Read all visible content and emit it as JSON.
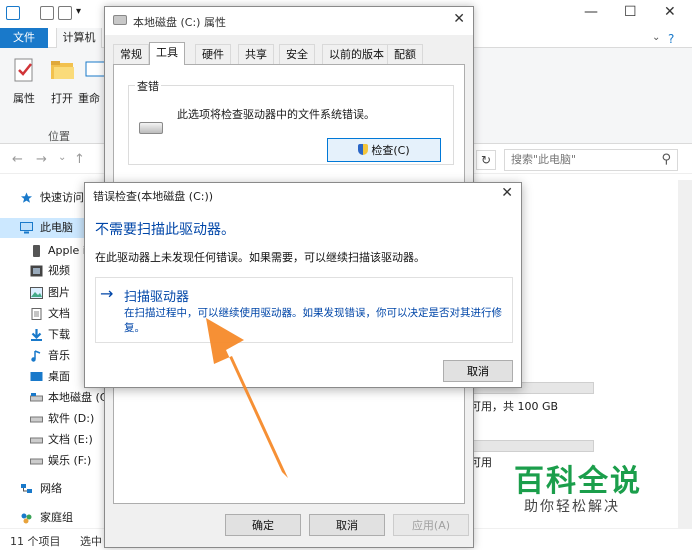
{
  "explorer": {
    "ribbon_tabs": {
      "file": "文件",
      "computer": "计算机"
    },
    "ribbon_buttons": [
      {
        "label": "属性",
        "icon": "properties-icon"
      },
      {
        "label": "打开",
        "icon": "open-folder-icon"
      },
      {
        "label": "重命",
        "icon": "rename-icon"
      }
    ],
    "ribbon_group": "位置",
    "search_placeholder": "搜索\"此电脑\"",
    "nav": [
      {
        "label": "快速访问",
        "icon": "star-icon"
      },
      {
        "label": "此电脑",
        "icon": "pc-icon"
      },
      {
        "label": "Apple i",
        "icon": "phone-icon"
      },
      {
        "label": "视频",
        "icon": "video-icon"
      },
      {
        "label": "图片",
        "icon": "pictures-icon"
      },
      {
        "label": "文档",
        "icon": "documents-icon"
      },
      {
        "label": "下载",
        "icon": "download-icon"
      },
      {
        "label": "音乐",
        "icon": "music-icon"
      },
      {
        "label": "桌面",
        "icon": "desktop-icon"
      },
      {
        "label": "本地磁盘 (C:)",
        "icon": "drive-icon"
      },
      {
        "label": "软件 (D:)",
        "icon": "drive-icon"
      },
      {
        "label": "文档 (E:)",
        "icon": "drive-icon"
      },
      {
        "label": "娱乐 (F:)",
        "icon": "drive-icon"
      },
      {
        "label": "网络",
        "icon": "network-icon"
      },
      {
        "label": "家庭组",
        "icon": "homegroup-icon"
      }
    ],
    "status": {
      "count": "11 个项目",
      "selected": "选中"
    },
    "drive_info_1": "可用，共 100 GB",
    "drive_info_2": "可用"
  },
  "props": {
    "title": "本地磁盘 (C:) 属性",
    "tabs": [
      "常规",
      "工具",
      "硬件",
      "共享",
      "安全",
      "以前的版本",
      "配额"
    ],
    "active_tab": "工具",
    "check_group": "查错",
    "check_desc": "此选项将检查驱动器中的文件系统错误。",
    "check_button": "检查(C)",
    "ok": "确定",
    "cancel": "取消",
    "apply": "应用(A)"
  },
  "error_check": {
    "title": "错误检查(本地磁盘 (C:))",
    "heading": "不需要扫描此驱动器。",
    "desc": "在此驱动器上未发现任何错误。如果需要，可以继续扫描该驱动器。",
    "scan_title": "扫描驱动器",
    "scan_desc": "在扫描过程中，可以继续使用驱动器。如果发现错误，你可以决定是否对其进行修复。",
    "cancel": "取消"
  },
  "watermark": {
    "title": "百科全说",
    "subtitle": "助你轻松解决"
  },
  "colors": {
    "accent": "#1979ca",
    "link_blue": "#0046a8",
    "arrow": "#f58a2a",
    "watermark": "#1b9e4b"
  }
}
